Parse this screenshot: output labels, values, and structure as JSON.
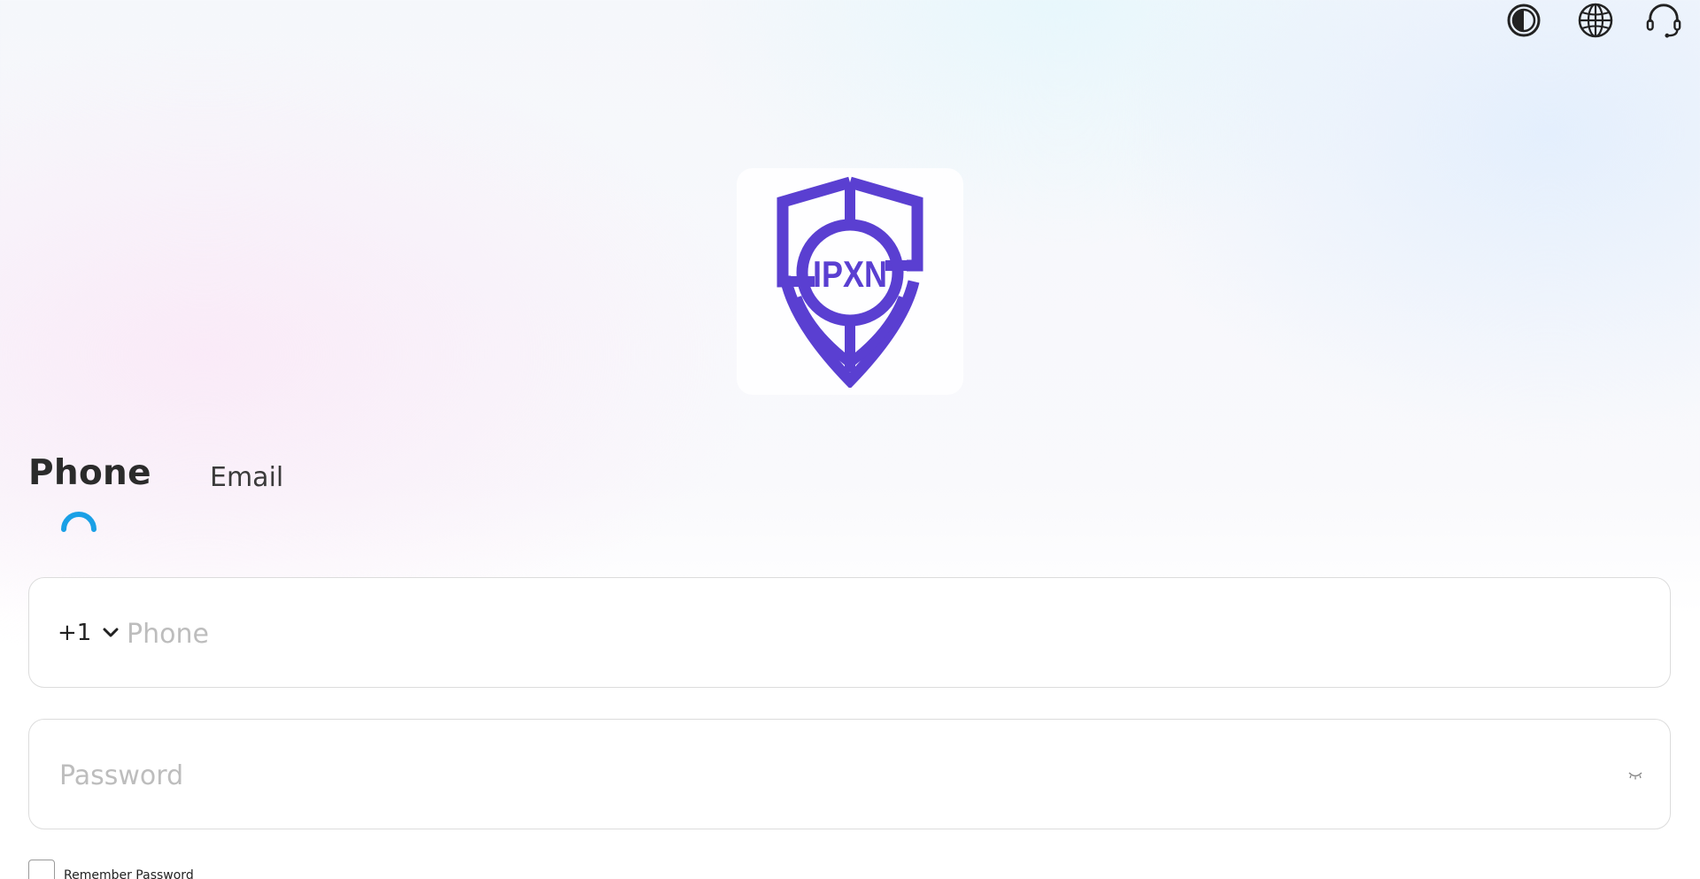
{
  "header": {
    "icons": [
      "theme-contrast-icon",
      "language-globe-icon",
      "customer-support-icon"
    ]
  },
  "logo": {
    "text": "IPXN",
    "color": "#5a3fd1"
  },
  "tabs": {
    "phone_label": "Phone",
    "email_label": "Email",
    "active": "Phone",
    "indicator_color": "#1aa0e6"
  },
  "phone_field": {
    "country_code": "+1",
    "placeholder": "Phone",
    "value": ""
  },
  "password_field": {
    "placeholder": "Password",
    "value": ""
  },
  "remember_password": {
    "label": "Remember Password",
    "checked": false
  }
}
